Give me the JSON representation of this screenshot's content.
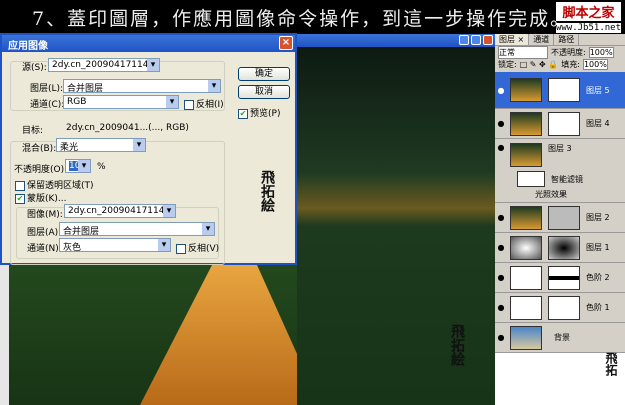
{
  "caption": "7、蓋印圖層，作應用圖像命令操作，到這一步操作完成。",
  "watermark": {
    "name": "脚本之家",
    "url": "www.Jb51.net"
  },
  "dialog": {
    "title": "应用图像",
    "source_label": "源(S):",
    "source_value": "2dy.cn_2009041711442...",
    "layer_label": "图层(L):",
    "layer_value": "合并图层",
    "channel_label": "通道(C):",
    "channel_value": "RGB",
    "invert_label": "反相(I)",
    "target_label": "目标:",
    "target_value": "2dy.cn_2009041...(..., RGB)",
    "blend_label": "混合(B):",
    "blend_value": "柔光",
    "opacity_label": "不透明度(O):",
    "opacity_value": "100",
    "opacity_unit": "%",
    "preserve_label": "保留透明区域(T)",
    "mask_label": "蒙版(K)...",
    "mask_image_label": "图像(M):",
    "mask_image_value": "2dy.cn_2009041711442...",
    "mask_layer_label": "图层(A):",
    "mask_layer_value": "合并图层",
    "mask_channel_label": "通道(N):",
    "mask_channel_value": "灰色",
    "mask_invert_label": "反相(V)",
    "ok": "确定",
    "cancel": "取消",
    "preview_label": "预览(P)"
  },
  "layers_panel": {
    "tabs": [
      "图层 ×",
      "通道",
      "路径"
    ],
    "blend_mode": "正常",
    "opacity_label": "不透明度:",
    "opacity_value": "100%",
    "lock_label": "锁定:",
    "fill_label": "填充:",
    "fill_value": "100%",
    "layers": [
      "图层 5",
      "图层 4",
      "图层 3",
      "智能滤镜",
      "光照效果",
      "图层 2",
      "图层 1",
      "色阶 2",
      "色阶 1",
      "背景"
    ]
  }
}
